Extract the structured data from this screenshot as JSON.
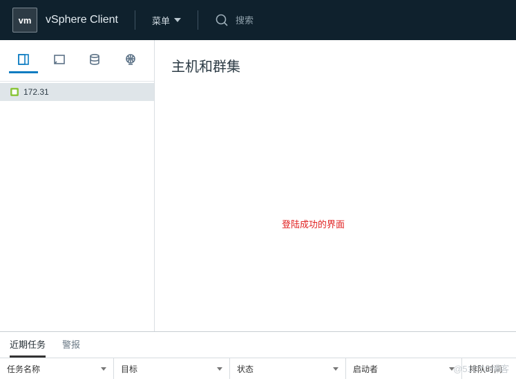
{
  "header": {
    "logo_text": "vm",
    "brand": "vSphere Client",
    "menu_label": "菜单",
    "search_placeholder": "搜索"
  },
  "sidebar": {
    "nav_icons": [
      "hosts",
      "vms",
      "storage",
      "network"
    ],
    "tree": {
      "items": [
        {
          "label": "172.31"
        }
      ]
    }
  },
  "content": {
    "title": "主机和群集",
    "annotation": "登陆成功的界面"
  },
  "bottom": {
    "tabs": [
      {
        "label": "近期任务",
        "active": true
      },
      {
        "label": "警报",
        "active": false
      }
    ],
    "columns": [
      {
        "label": "任务名称",
        "width": 165
      },
      {
        "label": "目标",
        "width": 168
      },
      {
        "label": "状态",
        "width": 168
      },
      {
        "label": "启动者",
        "width": 168
      },
      {
        "label": "排队时间",
        "width": 78,
        "no_chev": true
      }
    ]
  },
  "watermark": "@51CTO博客"
}
